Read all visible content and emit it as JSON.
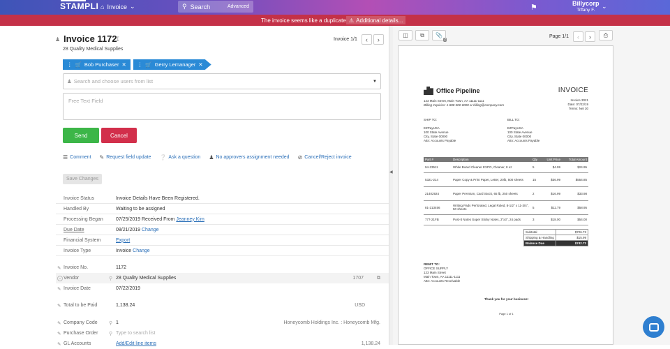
{
  "topbar": {
    "logo": "STAMPLI",
    "nav_label": "Invoice",
    "search_placeholder": "Search",
    "search_advanced": "Advanced",
    "org": "Billycorp",
    "user_name": "Tiffany F."
  },
  "alert": {
    "message": "The invoice seems like a duplicate",
    "button": "Additional details..."
  },
  "invoice": {
    "title": "Invoice 1172",
    "vendor_name": "28 Quality Medical Supplies",
    "pager": "Invoice 1/1"
  },
  "approvers": [
    {
      "name": "Bob Purchaser"
    },
    {
      "name": "Gerry Lemanager"
    }
  ],
  "form": {
    "user_select_placeholder": "Search and choose users from list",
    "free_text_placeholder": "Free Text Field",
    "send": "Send",
    "cancel": "Cancel",
    "save_changes": "Save Changes"
  },
  "actions": [
    {
      "icon": "list-icon",
      "label": "Comment"
    },
    {
      "icon": "pencil-icon",
      "label": "Request field update"
    },
    {
      "icon": "question-icon",
      "label": "Ask a question"
    },
    {
      "icon": "person-icon",
      "label": "No approvers assignment needed"
    },
    {
      "icon": "ban-icon",
      "label": "Cancel/Reject invoice"
    }
  ],
  "details": {
    "status_label": "Invoice Status",
    "status_value": "Invoice Details Have Been Registered.",
    "handled_label": "Handled By",
    "handled_value": "Waiting to be assigned",
    "began_label": "Processing Began",
    "began_value": "07/25/2019 Received From",
    "began_person": "Jeanney Kim",
    "due_label": "Due Date",
    "due_value": "08/21/2019",
    "due_change": "Change",
    "fin_label": "Financial System",
    "fin_value": "Export",
    "type_label": "Invoice Type",
    "type_value": "Invoice",
    "type_change": "Change"
  },
  "fields": {
    "invno_label": "Invoice No.",
    "invno_value": "1172",
    "vendor_label": "Vendor",
    "vendor_value": "28 Quality Medical Supplies",
    "vendor_code": "1707",
    "date_label": "Invoice Date",
    "date_value": "07/22/2019",
    "total_label": "Total to be Paid",
    "total_value": "1,138.24",
    "total_currency": "USD",
    "company_label": "Company Code",
    "company_value": "1",
    "company_name": "Honeycomb Holdings Inc. : Honeycomb Mfg.",
    "po_label": "Purchase Order",
    "po_placeholder": "Type to search list",
    "gl_label": "GL Accounts",
    "gl_value": "Add/Edit line items",
    "gl_amount": "1,138.24"
  },
  "viewer": {
    "page": "Page 1/1",
    "attachment_count": "2"
  },
  "document": {
    "company": "Office Pipeline",
    "heading": "INVOICE",
    "addr1": "123 Main Street, Main Town, AA 11111-1111",
    "addr2": "Billing Inquiries: 1-888-000-0000 or billing@company.com",
    "meta1": "Invoice 3021",
    "meta2": "Date: 07/22/19",
    "meta3": "Terms: Net 30",
    "ship_to": "SHIP TO:",
    "bill_to": "BILL TO:",
    "ship_lines": [
      "EZPayUSA",
      "100 State Avenue",
      "City, State 00000",
      "Attn: Accounts Payable"
    ],
    "bill_lines": [
      "EZPayUSA",
      "100 State Avenue",
      "City, State 00000",
      "Attn: Accounts Payable"
    ],
    "headers": [
      "Part #",
      "Description",
      "Qty",
      "Unit Price",
      "Total Amount"
    ],
    "rows": [
      {
        "part": "94-23511",
        "desc": "White Board Cleaner EXPO, Cleaner, 8 oz",
        "qty": "5",
        "unit": "$4.99",
        "total": "$24.95"
      },
      {
        "part": "5321-214",
        "desc": "Paper Copy & Print Paper, Letter, 20lb, 500 sheets",
        "qty": "15",
        "unit": "$36.99",
        "total": "$554.85"
      },
      {
        "part": "21402924",
        "desc": "Paper Premium, Card Stock, 65 lb, 250 sheets",
        "qty": "2",
        "unit": "$16.99",
        "total": "$33.98"
      },
      {
        "part": "81-213456",
        "desc": "Writing Pads Perforated, Legal Ruled, 8-1/2\" x 11-3/4\", 50 sheets",
        "qty": "5",
        "unit": "$11.79",
        "total": "$58.95"
      },
      {
        "part": "777-21FB",
        "desc": "Post-It Notes Super Sticky Notes, 3\"x3\", 24 pads",
        "qty": "3",
        "unit": "$18.00",
        "total": "$54.00"
      }
    ],
    "subtotal_label": "Subtotal",
    "subtotal": "$726.73",
    "shipping_label": "Shipping & Handling",
    "shipping": "$15.99",
    "due_label": "Balance Due",
    "due": "$742.72",
    "remit_lines": [
      "REMIT TO:",
      "OFFICE SUPPLY",
      "123 Main Street",
      "Main Town, AA 11111-1111",
      "Attn: Accounts Receivable"
    ],
    "thanks": "Thank you for your business!",
    "page": "Page 1 of 1"
  }
}
